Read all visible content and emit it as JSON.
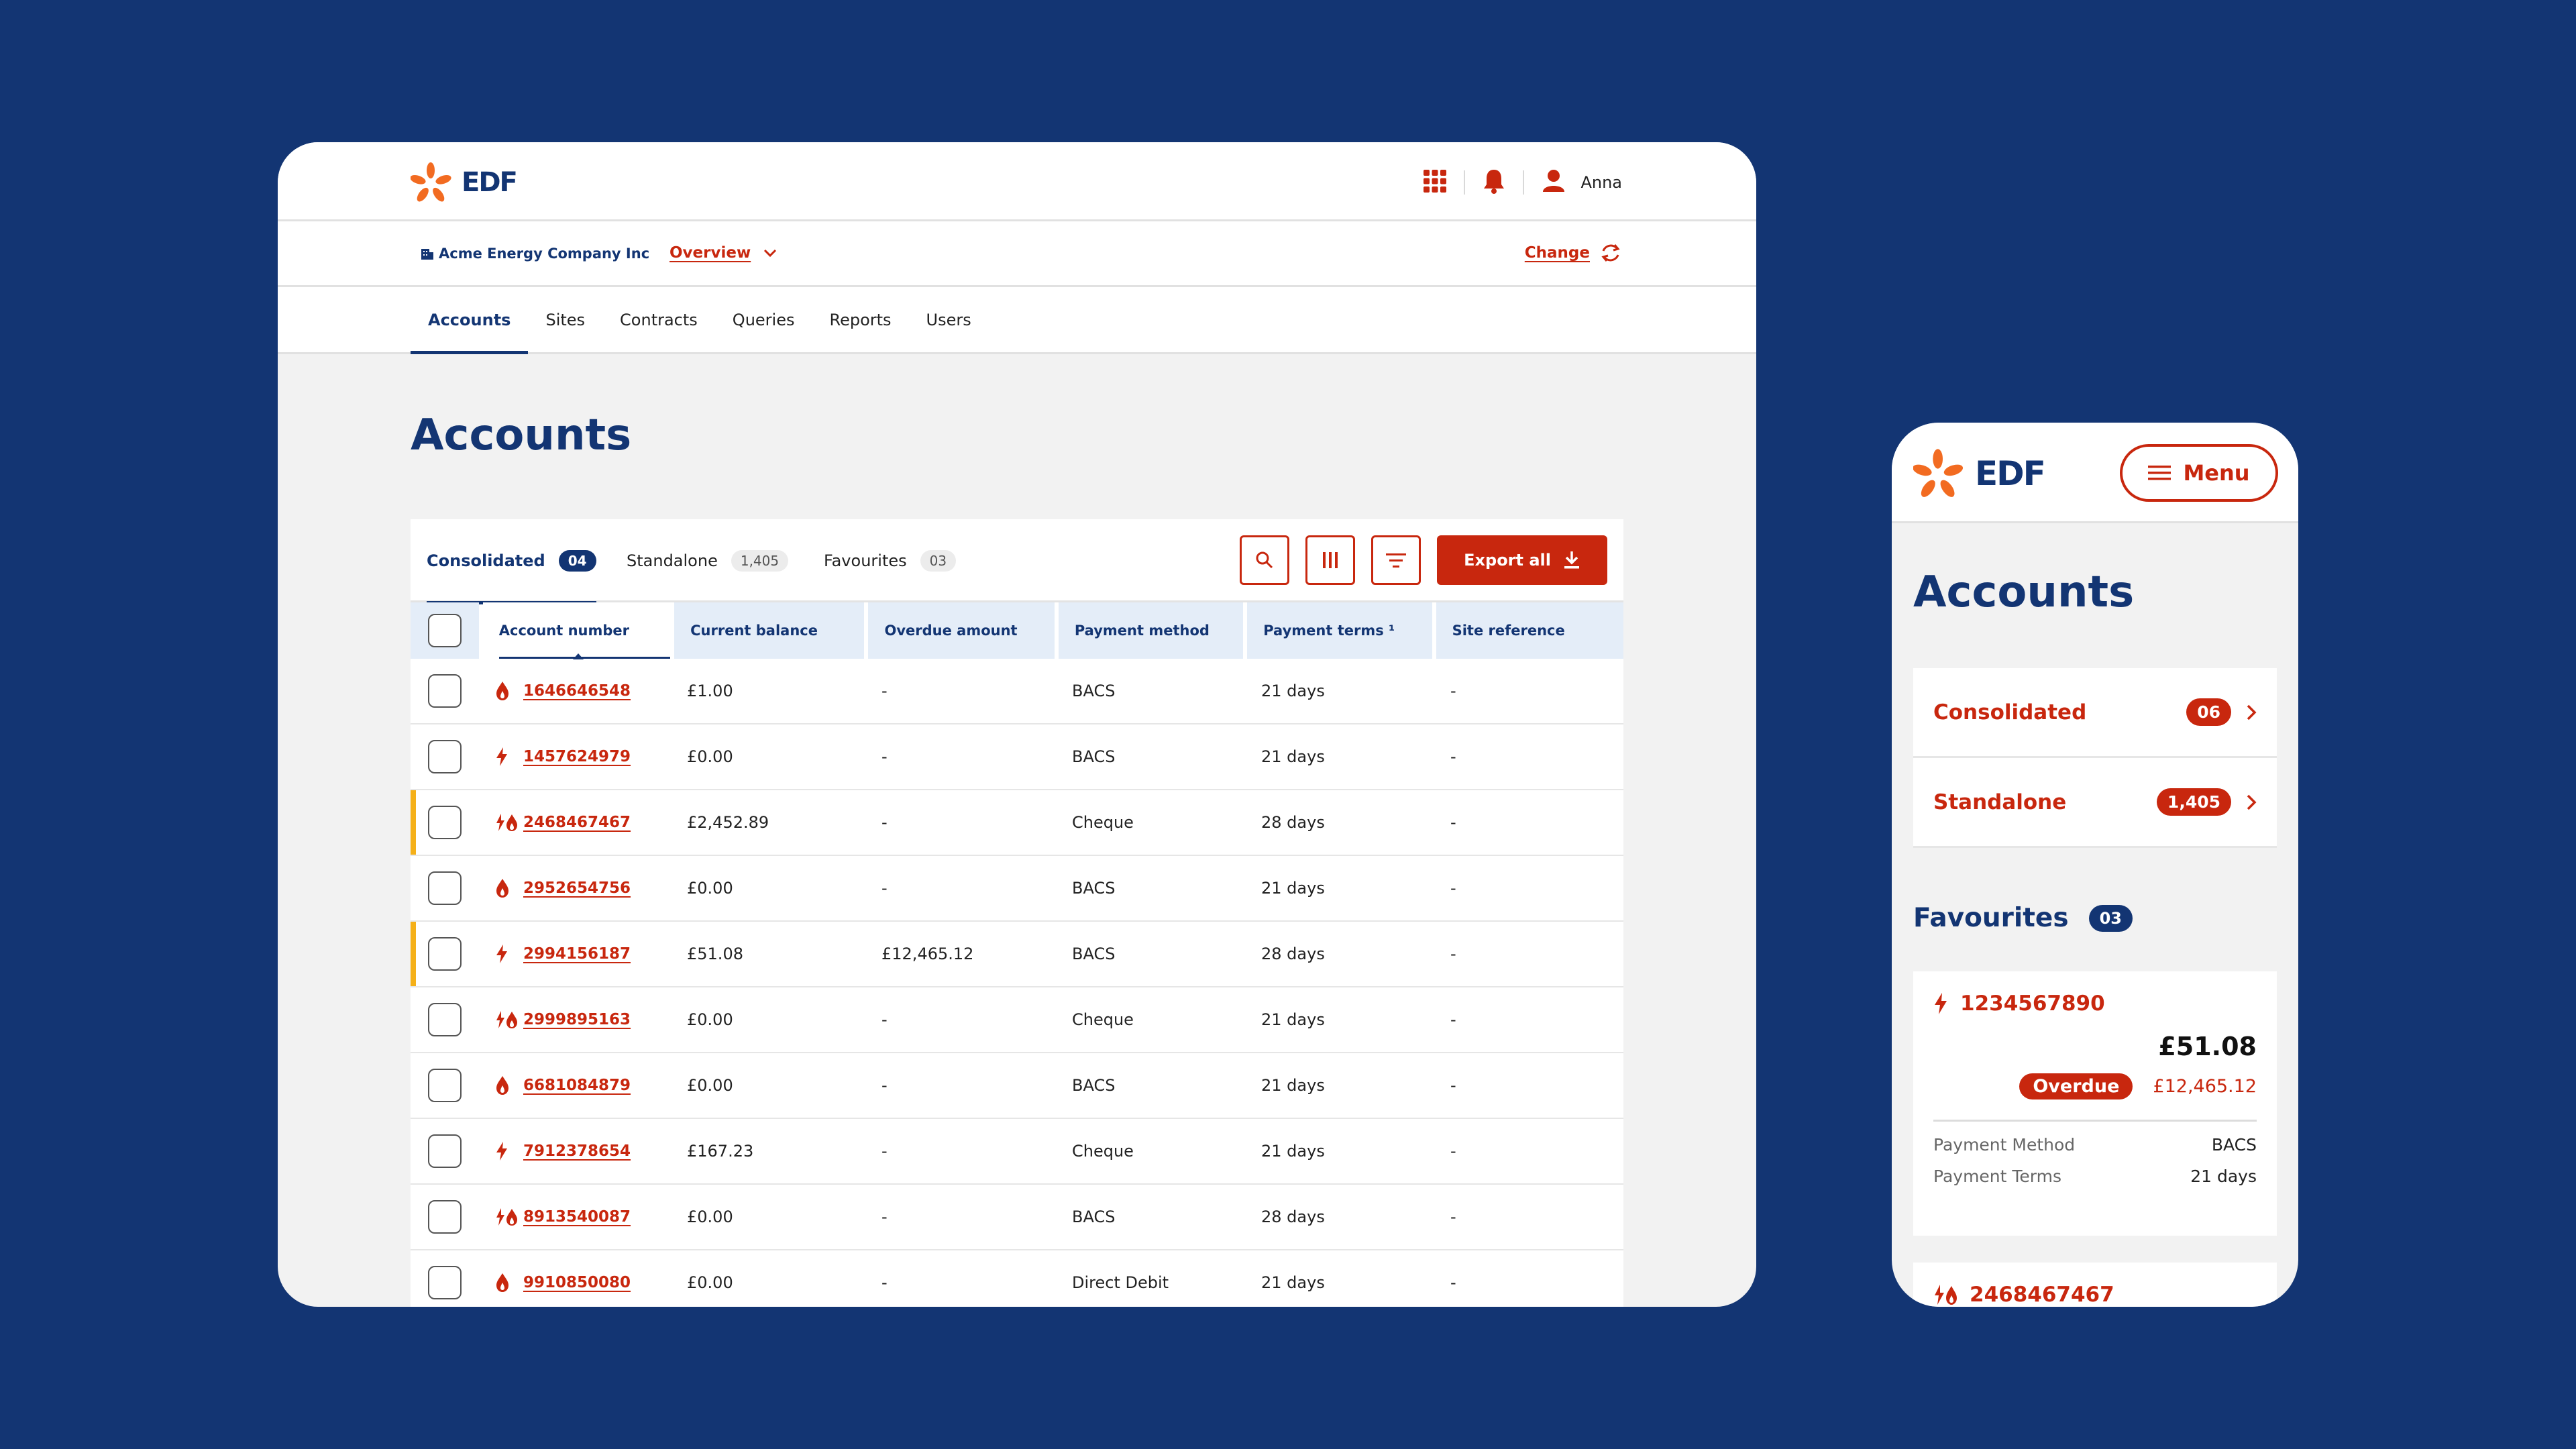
{
  "brand": {
    "logo_text": "EDF",
    "primary": "#133573",
    "accent": "#c8270e",
    "flag": "#f5b018"
  },
  "desktop": {
    "header": {
      "user_name": "Anna",
      "icons": [
        "apps-grid-icon",
        "bell-icon",
        "user-icon"
      ]
    },
    "subheader": {
      "company": "Acme Energy Company Inc",
      "view": "Overview",
      "change_label": "Change"
    },
    "nav": {
      "tabs": [
        "Accounts",
        "Sites",
        "Contracts",
        "Queries",
        "Reports",
        "Users"
      ],
      "active": "Accounts"
    },
    "page_title": "Accounts",
    "panel": {
      "tabs": [
        {
          "label": "Consolidated",
          "count": "04",
          "active": true
        },
        {
          "label": "Standalone",
          "count": "1,405",
          "active": false
        },
        {
          "label": "Favourites",
          "count": "03",
          "active": false
        }
      ],
      "export_label": "Export all",
      "columns": [
        "Account number",
        "Current balance",
        "Overdue amount",
        "Payment method",
        "Payment terms ¹",
        "Site reference"
      ],
      "rows": [
        {
          "type": "gas",
          "account": "1646646548",
          "balance": "£1.00",
          "overdue": "-",
          "method": "BACS",
          "terms": "21 days",
          "site": "-",
          "flag": false
        },
        {
          "type": "electric",
          "account": "1457624979",
          "balance": "£0.00",
          "overdue": "-",
          "method": "BACS",
          "terms": "21 days",
          "site": "-",
          "flag": false
        },
        {
          "type": "dual",
          "account": "2468467467",
          "balance": "£2,452.89",
          "overdue": "-",
          "method": "Cheque",
          "terms": "28 days",
          "site": "-",
          "flag": true
        },
        {
          "type": "gas",
          "account": "2952654756",
          "balance": "£0.00",
          "overdue": "-",
          "method": "BACS",
          "terms": "21 days",
          "site": "-",
          "flag": false
        },
        {
          "type": "electric",
          "account": "2994156187",
          "balance": "£51.08",
          "overdue": "£12,465.12",
          "method": "BACS",
          "terms": "28 days",
          "site": "-",
          "flag": true
        },
        {
          "type": "dual",
          "account": "2999895163",
          "balance": "£0.00",
          "overdue": "-",
          "method": "Cheque",
          "terms": "21 days",
          "site": "-",
          "flag": false
        },
        {
          "type": "gas",
          "account": "6681084879",
          "balance": "£0.00",
          "overdue": "-",
          "method": "BACS",
          "terms": "21 days",
          "site": "-",
          "flag": false
        },
        {
          "type": "electric",
          "account": "7912378654",
          "balance": "£167.23",
          "overdue": "-",
          "method": "Cheque",
          "terms": "21 days",
          "site": "-",
          "flag": false
        },
        {
          "type": "dual",
          "account": "8913540087",
          "balance": "£0.00",
          "overdue": "-",
          "method": "BACS",
          "terms": "28 days",
          "site": "-",
          "flag": false
        },
        {
          "type": "gas",
          "account": "9910850080",
          "balance": "£0.00",
          "overdue": "-",
          "method": "Direct Debit",
          "terms": "21 days",
          "site": "-",
          "flag": false
        }
      ]
    }
  },
  "mobile": {
    "menu_label": "Menu",
    "page_title": "Accounts",
    "list": [
      {
        "label": "Consolidated",
        "count": "06"
      },
      {
        "label": "Standalone",
        "count": "1,405"
      }
    ],
    "favourites": {
      "title": "Favourites",
      "count": "03",
      "card": {
        "account": "1234567890",
        "balance": "£51.08",
        "overdue_label": "Overdue",
        "overdue_amount": "£12,465.12",
        "method_label": "Payment Method",
        "method": "BACS",
        "terms_label": "Payment Terms",
        "terms": "21 days"
      },
      "next_account": "2468467467"
    }
  }
}
